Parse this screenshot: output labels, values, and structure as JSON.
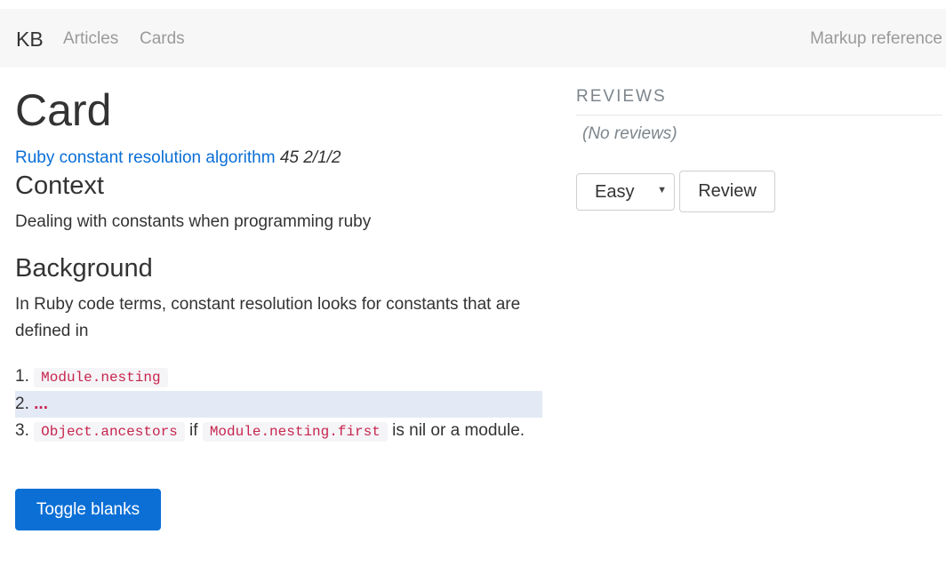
{
  "navbar": {
    "brand": "KB",
    "links": [
      "Articles",
      "Cards"
    ],
    "right_link": "Markup reference"
  },
  "card": {
    "title": "Card",
    "article_link": "Ruby constant resolution algorithm",
    "stats": "45 2/1/2",
    "context_heading": "Context",
    "context_text": "Dealing with constants when programming ruby",
    "background_heading": "Background",
    "background_text": "In Ruby code terms, constant resolution looks for constants that are defined in",
    "steps": [
      {
        "num": "1.",
        "code": "Module.nesting"
      },
      {
        "num": "2.",
        "blank": "..."
      },
      {
        "num": "3.",
        "code": "Object.ancestors",
        "text1": "if",
        "code2": "Module.nesting.first",
        "text2": "is nil or a module."
      }
    ],
    "toggle_button": "Toggle blanks"
  },
  "reviews": {
    "title": "REVIEWS",
    "empty_text": "(No reviews)",
    "grade_select": "Easy",
    "review_button": "Review"
  }
}
